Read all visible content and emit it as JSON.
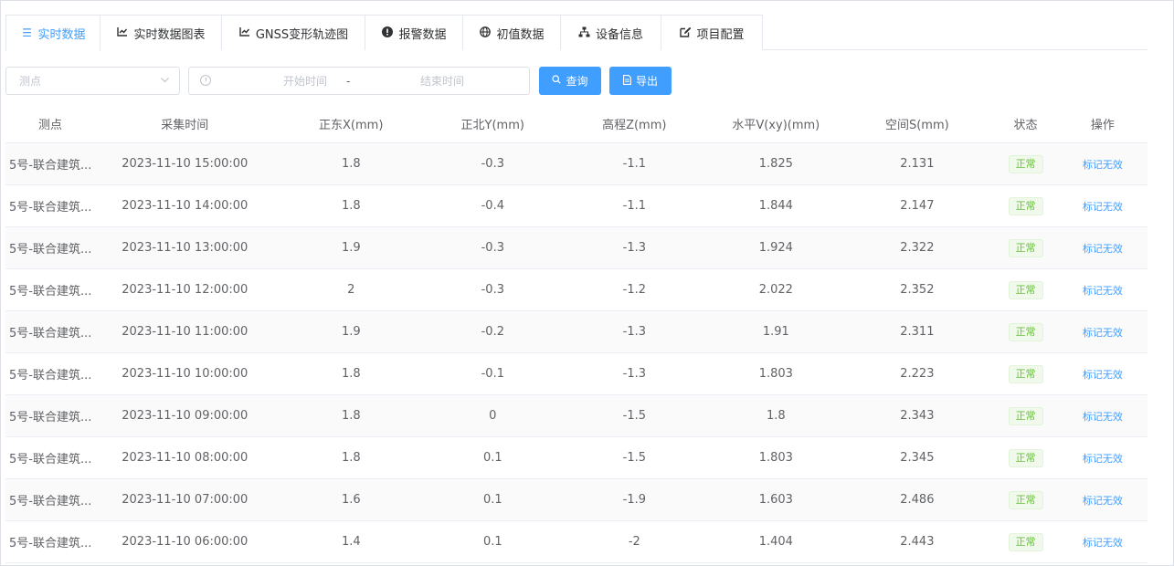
{
  "tabs": [
    {
      "label": "实时数据",
      "icon": "list-icon",
      "active": true
    },
    {
      "label": "实时数据图表",
      "icon": "line-chart-icon",
      "active": false
    },
    {
      "label": "GNSS变形轨迹图",
      "icon": "line-chart-icon",
      "active": false
    },
    {
      "label": "报警数据",
      "icon": "alert-circle-icon",
      "active": false
    },
    {
      "label": "初值数据",
      "icon": "globe-icon",
      "active": false
    },
    {
      "label": "设备信息",
      "icon": "sitemap-icon",
      "active": false
    },
    {
      "label": "项目配置",
      "icon": "edit-icon",
      "active": false
    }
  ],
  "filters": {
    "point_placeholder": "测点",
    "start_placeholder": "开始时间",
    "separator": "-",
    "end_placeholder": "结束时间",
    "query_label": "查询",
    "export_label": "导出"
  },
  "columns": [
    "测点",
    "采集时间",
    "正东X(mm)",
    "正北Y(mm)",
    "高程Z(mm)",
    "水平V(xy)(mm)",
    "空间S(mm)",
    "状态",
    "操作"
  ],
  "rows": [
    {
      "point": "5号-联合建筑...",
      "time": "2023-11-10 15:00:00",
      "x": "1.8",
      "y": "-0.3",
      "z": "-1.1",
      "v": "1.825",
      "s": "2.131",
      "status": "正常",
      "action": "标记无效"
    },
    {
      "point": "5号-联合建筑...",
      "time": "2023-11-10 14:00:00",
      "x": "1.8",
      "y": "-0.4",
      "z": "-1.1",
      "v": "1.844",
      "s": "2.147",
      "status": "正常",
      "action": "标记无效"
    },
    {
      "point": "5号-联合建筑...",
      "time": "2023-11-10 13:00:00",
      "x": "1.9",
      "y": "-0.3",
      "z": "-1.3",
      "v": "1.924",
      "s": "2.322",
      "status": "正常",
      "action": "标记无效"
    },
    {
      "point": "5号-联合建筑...",
      "time": "2023-11-10 12:00:00",
      "x": "2",
      "y": "-0.3",
      "z": "-1.2",
      "v": "2.022",
      "s": "2.352",
      "status": "正常",
      "action": "标记无效"
    },
    {
      "point": "5号-联合建筑...",
      "time": "2023-11-10 11:00:00",
      "x": "1.9",
      "y": "-0.2",
      "z": "-1.3",
      "v": "1.91",
      "s": "2.311",
      "status": "正常",
      "action": "标记无效"
    },
    {
      "point": "5号-联合建筑...",
      "time": "2023-11-10 10:00:00",
      "x": "1.8",
      "y": "-0.1",
      "z": "-1.3",
      "v": "1.803",
      "s": "2.223",
      "status": "正常",
      "action": "标记无效"
    },
    {
      "point": "5号-联合建筑...",
      "time": "2023-11-10 09:00:00",
      "x": "1.8",
      "y": "0",
      "z": "-1.5",
      "v": "1.8",
      "s": "2.343",
      "status": "正常",
      "action": "标记无效"
    },
    {
      "point": "5号-联合建筑...",
      "time": "2023-11-10 08:00:00",
      "x": "1.8",
      "y": "0.1",
      "z": "-1.5",
      "v": "1.803",
      "s": "2.345",
      "status": "正常",
      "action": "标记无效"
    },
    {
      "point": "5号-联合建筑...",
      "time": "2023-11-10 07:00:00",
      "x": "1.6",
      "y": "0.1",
      "z": "-1.9",
      "v": "1.603",
      "s": "2.486",
      "status": "正常",
      "action": "标记无效"
    },
    {
      "point": "5号-联合建筑...",
      "time": "2023-11-10 06:00:00",
      "x": "1.4",
      "y": "0.1",
      "z": "-2",
      "v": "1.404",
      "s": "2.443",
      "status": "正常",
      "action": "标记无效"
    }
  ],
  "colors": {
    "accent": "#409eff",
    "success": "#67c23a"
  }
}
